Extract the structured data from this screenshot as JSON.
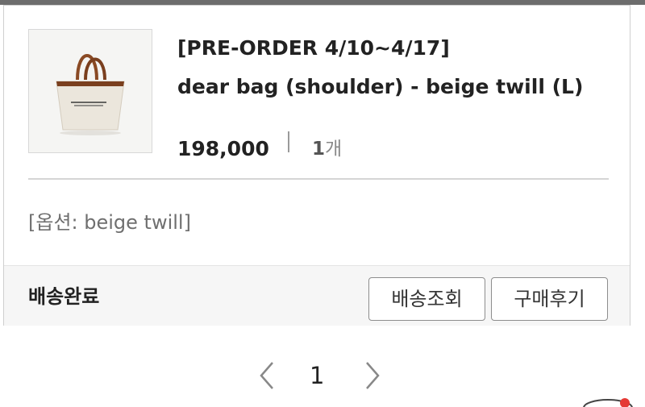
{
  "order": {
    "title_line1": "[PRE-ORDER 4/10~4/17]",
    "title_line2": "dear bag (shoulder) - beige twill (L)",
    "price": "198,000",
    "quantity_number": "1",
    "quantity_unit": "개",
    "option": "[옵션: beige twill]"
  },
  "footer": {
    "status": "배송완료",
    "track_label": "배송조회",
    "review_label": "구매후기"
  },
  "pagination": {
    "current_page": "1"
  },
  "colors": {
    "text": "#222222",
    "muted": "#888888",
    "border": "#cfcfcf",
    "footer_bg": "#f6f6f6"
  }
}
